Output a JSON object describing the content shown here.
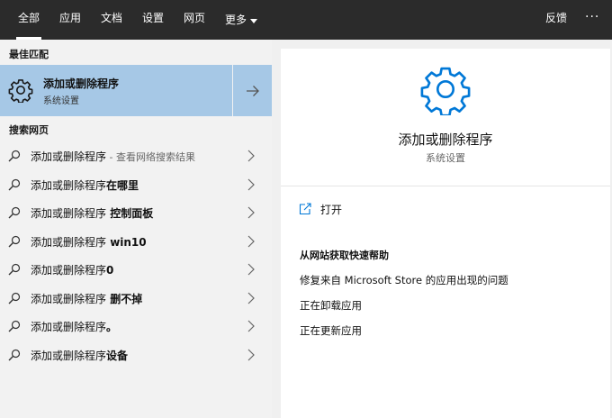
{
  "tabs": [
    {
      "label": "全部",
      "active": true
    },
    {
      "label": "应用",
      "active": false
    },
    {
      "label": "文档",
      "active": false
    },
    {
      "label": "设置",
      "active": false
    },
    {
      "label": "网页",
      "active": false
    },
    {
      "label": "更多",
      "active": false
    }
  ],
  "topbar": {
    "feedback": "反馈",
    "more_icon": "ellipsis-icon",
    "ellipsis": "···"
  },
  "best_match": {
    "section_label": "最佳匹配",
    "title": "添加或删除程序",
    "subtitle": "系统设置",
    "icon": "gear-icon",
    "arrow_icon": "arrow-right-icon"
  },
  "web_search": {
    "section_label": "搜索网页",
    "items": [
      {
        "query": "添加或删除程序",
        "suffix": "",
        "hint": " - 查看网络搜索结果"
      },
      {
        "query": "添加或删除程序",
        "suffix": "在哪里",
        "hint": ""
      },
      {
        "query": "添加或删除程序",
        "suffix": " 控制面板",
        "hint": ""
      },
      {
        "query": "添加或删除程序",
        "suffix": " win10",
        "hint": ""
      },
      {
        "query": "添加或删除程序",
        "suffix": "0",
        "hint": ""
      },
      {
        "query": "添加或删除程序",
        "suffix": " 删不掉",
        "hint": ""
      },
      {
        "query": "添加或删除程序",
        "suffix": "。",
        "hint": ""
      },
      {
        "query": "添加或删除程序",
        "suffix": "设备",
        "hint": ""
      }
    ]
  },
  "preview": {
    "icon": "gear-icon",
    "title": "添加或删除程序",
    "subtitle": "系统设置",
    "open_label": "打开",
    "open_icon": "open-external-icon",
    "help_title": "从网站获取快速帮助",
    "help_links": [
      "修复来自 Microsoft Store 的应用出现的问题",
      "正在卸载应用",
      "正在更新应用"
    ]
  },
  "colors": {
    "accent": "#0078d7",
    "selection": "#a6c8e6",
    "topbar": "#2b2b2b"
  }
}
